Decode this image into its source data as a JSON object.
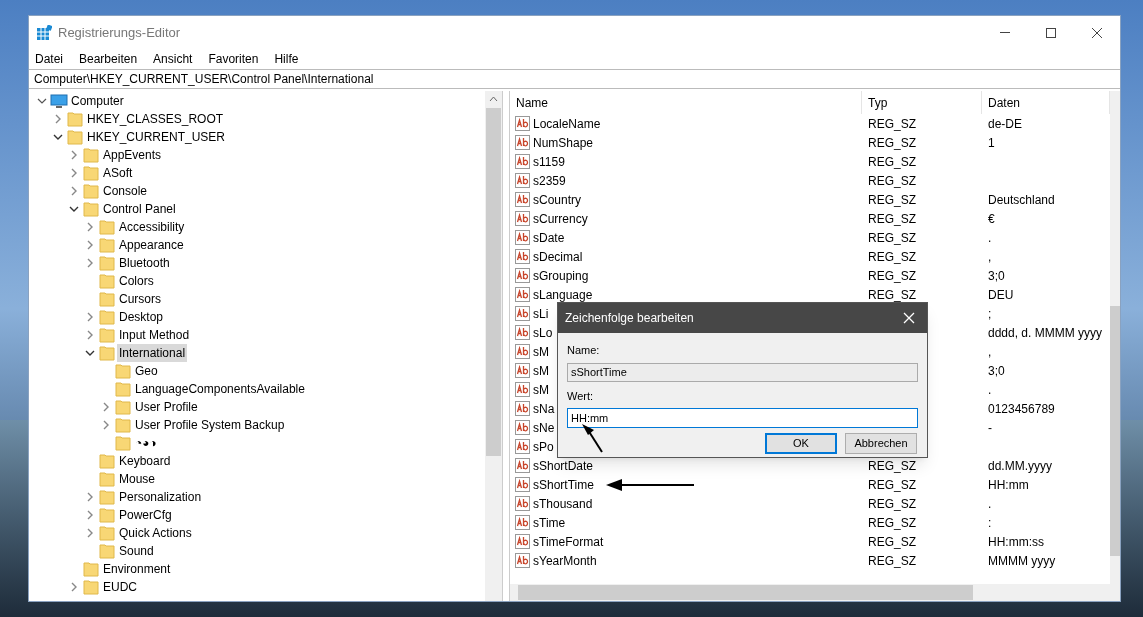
{
  "window": {
    "title": "Registrierungs-Editor"
  },
  "menu": [
    "Datei",
    "Bearbeiten",
    "Ansicht",
    "Favoriten",
    "Hilfe"
  ],
  "address": "Computer\\HKEY_CURRENT_USER\\Control Panel\\International",
  "tree_root": {
    "label": "Computer",
    "expanded": true,
    "selected": false,
    "children": [
      {
        "label": "HKEY_CLASSES_ROOT",
        "kind": "closed",
        "selected": false
      },
      {
        "label": "HKEY_CURRENT_USER",
        "kind": "open",
        "selected": false,
        "children": [
          {
            "label": "AppEvents",
            "kind": "closed",
            "selected": false
          },
          {
            "label": "ASoft",
            "kind": "closed",
            "selected": false
          },
          {
            "label": "Console",
            "kind": "closed",
            "selected": false
          },
          {
            "label": "Control Panel",
            "kind": "open",
            "selected": false,
            "children": [
              {
                "label": "Accessibility",
                "kind": "closed",
                "selected": false
              },
              {
                "label": "Appearance",
                "kind": "closed",
                "selected": false
              },
              {
                "label": "Bluetooth",
                "kind": "closed",
                "selected": false
              },
              {
                "label": "Colors",
                "kind": "leaf",
                "selected": false
              },
              {
                "label": "Cursors",
                "kind": "leaf",
                "selected": false
              },
              {
                "label": "Desktop",
                "kind": "closed",
                "selected": false
              },
              {
                "label": "Input Method",
                "kind": "closed",
                "selected": false
              },
              {
                "label": "International",
                "kind": "open",
                "selected": true,
                "children": [
                  {
                    "label": "Geo",
                    "kind": "leaf",
                    "selected": false
                  },
                  {
                    "label": "LanguageComponentsAvailable",
                    "kind": "leaf",
                    "selected": false
                  },
                  {
                    "label": "User Profile",
                    "kind": "closed",
                    "selected": false
                  },
                  {
                    "label": "User Profile System Backup",
                    "kind": "closed",
                    "selected": false
                  },
                  {
                    "label": "◔◕◑",
                    "kind": "leaf",
                    "selected": false
                  }
                ]
              },
              {
                "label": "Keyboard",
                "kind": "leaf",
                "selected": false
              },
              {
                "label": "Mouse",
                "kind": "leaf",
                "selected": false
              },
              {
                "label": "Personalization",
                "kind": "closed",
                "selected": false
              },
              {
                "label": "PowerCfg",
                "kind": "closed",
                "selected": false
              },
              {
                "label": "Quick Actions",
                "kind": "closed",
                "selected": false
              },
              {
                "label": "Sound",
                "kind": "leaf",
                "selected": false
              }
            ]
          },
          {
            "label": "Environment",
            "kind": "leaf",
            "selected": false
          },
          {
            "label": "EUDC",
            "kind": "closed",
            "selected": false
          }
        ]
      }
    ]
  },
  "columns": [
    "Name",
    "Typ",
    "Daten"
  ],
  "rows": [
    {
      "name": "LocaleName",
      "type": "REG_SZ",
      "data": "de-DE"
    },
    {
      "name": "NumShape",
      "type": "REG_SZ",
      "data": "1"
    },
    {
      "name": "s1159",
      "type": "REG_SZ"
    },
    {
      "name": "s2359",
      "type": "REG_SZ"
    },
    {
      "name": "sCountry",
      "type": "REG_SZ",
      "data": "Deutschland"
    },
    {
      "name": "sCurrency",
      "type": "REG_SZ",
      "data": "€"
    },
    {
      "name": "sDate",
      "type": "REG_SZ",
      "data": "."
    },
    {
      "name": "sDecimal",
      "type": "REG_SZ",
      "data": ","
    },
    {
      "name": "sGrouping",
      "type": "REG_SZ",
      "data": "3;0"
    },
    {
      "name": "sLanguage",
      "type": "REG_SZ",
      "data": "DEU"
    },
    {
      "name": "sLi",
      "data": ";"
    },
    {
      "name": "sLo",
      "data": "dddd, d. MMMM yyyy"
    },
    {
      "name": "sM",
      "data": ","
    },
    {
      "name": "sM",
      "data": "3;0"
    },
    {
      "name": "sM",
      "data": "."
    },
    {
      "name": "sNa",
      "data": "0123456789"
    },
    {
      "name": "sNe",
      "data": "-"
    },
    {
      "name": "sPo"
    },
    {
      "name": "sShortDate",
      "type": "REG_SZ",
      "data": "dd.MM.yyyy"
    },
    {
      "name": "sShortTime",
      "type": "REG_SZ",
      "data": "HH:mm"
    },
    {
      "name": "sThousand",
      "type": "REG_SZ",
      "data": "."
    },
    {
      "name": "sTime",
      "type": "REG_SZ",
      "data": ":"
    },
    {
      "name": "sTimeFormat",
      "type": "REG_SZ",
      "data": "HH:mm:ss"
    },
    {
      "name": "sYearMonth",
      "type": "REG_SZ",
      "data": "MMMM yyyy"
    }
  ],
  "dialog": {
    "title": "Zeichenfolge bearbeiten",
    "name_label": "Name:",
    "name_value": "sShortTime",
    "value_label": "Wert:",
    "value": "HH:mm",
    "buttons": [
      {
        "label": "OK",
        "default": true
      },
      {
        "label": "Abbrechen",
        "default": false
      }
    ]
  }
}
